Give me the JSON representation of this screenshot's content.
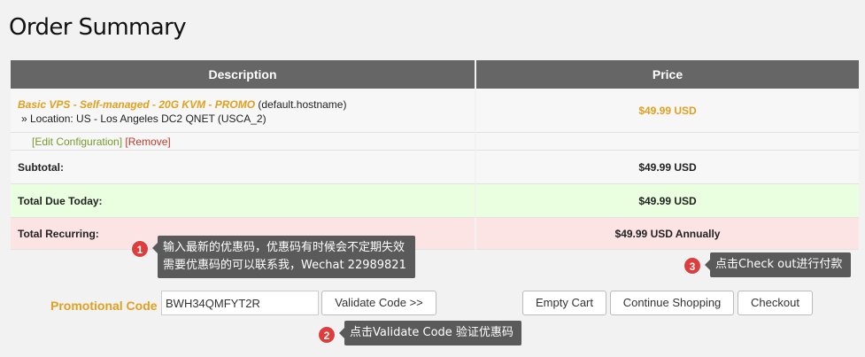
{
  "page": {
    "title": "Order Summary"
  },
  "table": {
    "headers": {
      "description": "Description",
      "price": "Price"
    },
    "product": {
      "name": "Basic VPS - Self-managed - 20G KVM - PROMO",
      "hostname": "(default.hostname)",
      "location": "» Location: US - Los Angeles DC2 QNET (USCA_2)",
      "price": "$49.99 USD",
      "edit_label": "[Edit Configuration]",
      "remove_label": "[Remove]"
    },
    "subtotal": {
      "label": "Subtotal:",
      "value": "$49.99 USD"
    },
    "total_due": {
      "label": "Total Due Today:",
      "value": "$49.99 USD"
    },
    "recurring": {
      "label": "Total Recurring:",
      "value": "$49.99 USD Annually"
    }
  },
  "annotations": [
    {
      "number": "1",
      "text_line1": "输入最新的优惠码，优惠码有时候会不定期失效",
      "text_line2": "需要优惠码的可以联系我，Wechat 22989821"
    },
    {
      "number": "2",
      "text": "点击Validate Code 验证优惠码"
    },
    {
      "number": "3",
      "text": "点击Check out进行付款"
    }
  ],
  "promo": {
    "label": "Promotional Code",
    "value": "BWH34QMFYT2R",
    "validate_label": "Validate Code >>"
  },
  "actions": {
    "empty_cart": "Empty Cart",
    "continue_shopping": "Continue Shopping",
    "checkout": "Checkout"
  },
  "colors": {
    "header_bg": "#666666",
    "accent_orange": "#e0a020",
    "due_row_bg": "#eaffe0",
    "recurring_row_bg": "#fde4e4",
    "badge_red": "#e03c3c"
  }
}
